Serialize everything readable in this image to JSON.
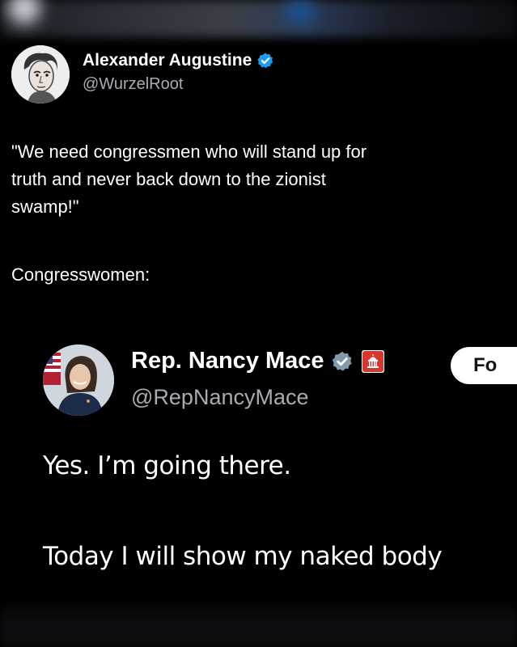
{
  "outer_tweet": {
    "display_name": "Alexander Augustine",
    "handle": "@WurzelRoot",
    "text": "\"We need congressmen who will stand up for\ntruth and never back down to the zionist\nswamp!\"",
    "text2": "Congresswomen:"
  },
  "embedded_tweet": {
    "display_name": "Rep. Nancy Mace",
    "handle": "@RepNancyMace",
    "follow_label": "Fo",
    "line1": "Yes. I’m going there.",
    "line2": "Today I will show my naked body"
  },
  "colors": {
    "background": "#000000",
    "text": "#ffffff",
    "secondary_text": "#a7acb2",
    "verified_blue": "#1d9bf0",
    "gov_badge_red": "#d4372c"
  }
}
